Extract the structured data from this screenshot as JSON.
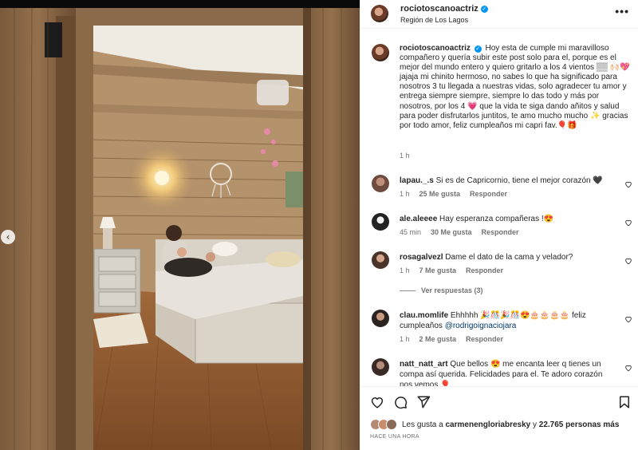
{
  "post": {
    "username": "rociotoscanoactriz",
    "location": "Región de Los Lagos",
    "caption_user": "rociotoscanoactriz",
    "caption_text": "Hoy esta de cumple mi maravilloso compañero y quería subir este post solo para el, porque es el mejor del mundo entero y quiero gritarlo a los 4 vientos ▒▒ 🙌🏻💖 jajaja mi chinito hermoso, no sabes lo que ha significado para nosotros 3 tu llegada a nuestras vidas, solo agradecer tu amor y entrega siempre siempre, siempre lo das todo y más por nosotros, por los 4 💗 que la vida te siga dando añitos y salud para poder disfrutarlos juntitos, te amo mucho mucho ✨ gracias por todo amor, feliz cumpleaños mi capri fav.🎈🎁",
    "caption_time": "1 h",
    "more_icon": "•••"
  },
  "comments": [
    {
      "user": "lapau._.s",
      "text": "Si es de Capricornio, tiene el mejor corazón 🖤",
      "time": "1 h",
      "likes": "25 Me gusta",
      "reply": "Responder"
    },
    {
      "user": "ale.aleeee",
      "text": "Hay esperanza compañeras !😍",
      "time": "45 min",
      "likes": "30 Me gusta",
      "reply": "Responder"
    },
    {
      "user": "rosagalvezl",
      "text": "Dame el dato de la cama y velador?",
      "time": "1 h",
      "likes": "7 Me gusta",
      "reply": "Responder",
      "view_replies": "Ver respuestas (3)"
    },
    {
      "user": "clau.momlife",
      "text": "Ehhhhh 🎉🎊🎉🎊😍🎂🎂🎂🎂 feliz cumpleaños ",
      "mention": "@rodrigoignaciojara",
      "time": "1 h",
      "likes": "2 Me gusta",
      "reply": "Responder"
    },
    {
      "user": "natt_natt_art",
      "text": "Que bellos 😍 me encanta leer q tienes un compa así querida. Felicidades para el. Te adoro corazón nos vemos 🎈"
    }
  ],
  "footer": {
    "likes_prefix": "Les gusta a",
    "likes_user": "carmenengloriabresky",
    "likes_join": "y",
    "likes_count": "22.765 personas más",
    "posted_ago": "HACE UNA HORA"
  },
  "nav": {
    "prev_glyph": "‹"
  },
  "colors": {
    "link": "#00376b",
    "verified": "#0095f6",
    "muted": "#737373"
  }
}
